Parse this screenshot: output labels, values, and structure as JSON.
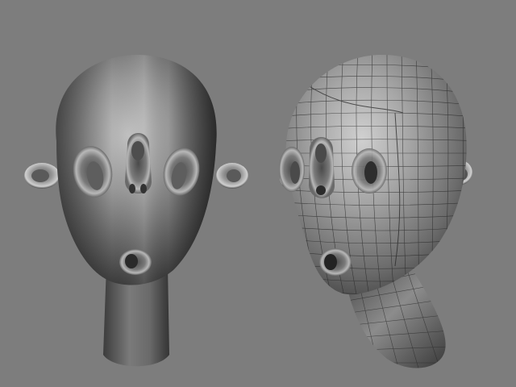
{
  "scene": {
    "background_color": "#7d7d7d",
    "panels": [
      {
        "id": "left",
        "model": "head-sculpt",
        "shading": "smooth"
      },
      {
        "id": "right",
        "model": "head-sculpt",
        "shading": "wireframe-over-smooth"
      }
    ]
  }
}
